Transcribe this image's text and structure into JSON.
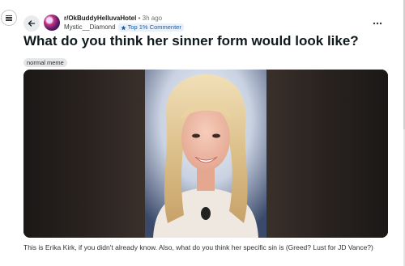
{
  "post": {
    "community": "r/OkBuddyHelluvaHotel",
    "separator": "•",
    "time_ago": "3h ago",
    "author": "Mystic__Diamond",
    "author_badge": "Top 1% Commenter",
    "title": "What do you think her sinner form would look like?",
    "flair": "normal meme",
    "body": "This is Erika Kirk, if you didn't already know. Also, what do you think her specific sin is (Greed? Lust for JD Vance?)"
  },
  "icons": {
    "menu": "menu-icon",
    "back": "arrow-left-icon",
    "more": "more-horizontal-icon",
    "badge": "badge-icon"
  },
  "colors": {
    "badge_bg": "#e8f1fb",
    "badge_text": "#1a5da8",
    "flair_bg": "#e4e6e8",
    "title": "#0f1a1c"
  }
}
